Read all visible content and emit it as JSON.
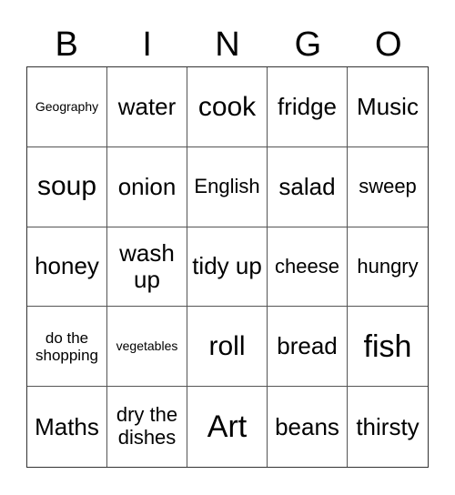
{
  "header": [
    "B",
    "I",
    "N",
    "G",
    "O"
  ],
  "cells": [
    {
      "text": "Geography",
      "size": "s-xs"
    },
    {
      "text": "water",
      "size": "s-lg"
    },
    {
      "text": "cook",
      "size": "s-xl"
    },
    {
      "text": "fridge",
      "size": "s-lg"
    },
    {
      "text": "Music",
      "size": "s-lg"
    },
    {
      "text": "soup",
      "size": "s-xl"
    },
    {
      "text": "onion",
      "size": "s-lg"
    },
    {
      "text": "English",
      "size": "s-md"
    },
    {
      "text": "salad",
      "size": "s-lg"
    },
    {
      "text": "sweep",
      "size": "s-md"
    },
    {
      "text": "honey",
      "size": "s-lg"
    },
    {
      "text": "wash up",
      "size": "s-lg"
    },
    {
      "text": "tidy up",
      "size": "s-lg"
    },
    {
      "text": "cheese",
      "size": "s-md"
    },
    {
      "text": "hungry",
      "size": "s-md"
    },
    {
      "text": "do the shopping",
      "size": "s-sm"
    },
    {
      "text": "vegetables",
      "size": "s-xs"
    },
    {
      "text": "roll",
      "size": "s-xl"
    },
    {
      "text": "bread",
      "size": "s-lg"
    },
    {
      "text": "fish",
      "size": "s-xxl"
    },
    {
      "text": "Maths",
      "size": "s-lg"
    },
    {
      "text": "dry the dishes",
      "size": "s-md"
    },
    {
      "text": "Art",
      "size": "s-xxl"
    },
    {
      "text": "beans",
      "size": "s-lg"
    },
    {
      "text": "thirsty",
      "size": "s-lg"
    }
  ]
}
